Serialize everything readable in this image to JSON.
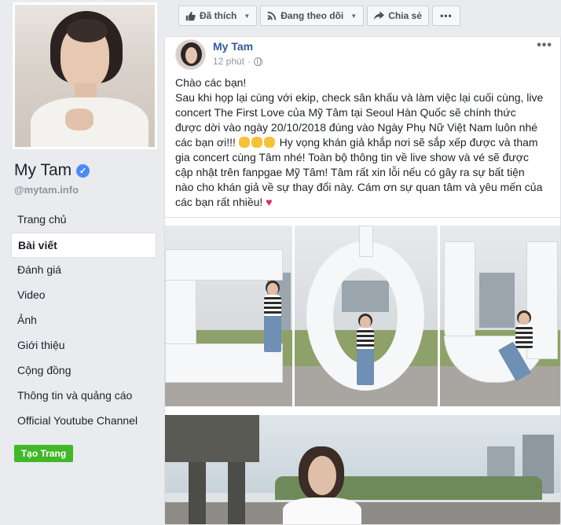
{
  "sidebar": {
    "page_name": "My Tam",
    "username": "@mytam.info",
    "nav": [
      {
        "label": "Trang chủ"
      },
      {
        "label": "Bài viết"
      },
      {
        "label": "Đánh giá"
      },
      {
        "label": "Video"
      },
      {
        "label": "Ảnh"
      },
      {
        "label": "Giới thiệu"
      },
      {
        "label": "Cộng đồng"
      },
      {
        "label": "Thông tin và quảng cáo"
      },
      {
        "label": "Official Youtube Channel"
      }
    ],
    "active_nav": "Bài viết",
    "create_page_label": "Tạo Trang"
  },
  "actionbar": {
    "liked_label": "Đã thích",
    "following_label": "Đang theo dõi",
    "share_label": "Chia sẻ",
    "more_label": "•••"
  },
  "post": {
    "author": "My Tam",
    "time": "12 phút",
    "privacy_icon": "globe-icon",
    "menu_label": "•••",
    "greeting": "Chào các bạn!",
    "body_part1": "Sau khi họp lại cùng với ekip, check sân khấu và làm việc lại cuối cùng, live concert The First Love của Mỹ Tâm tại Seoul Hàn Quốc sẽ chính thức được dời vào ngày 20/10/2018 đúng vào Ngày Phụ Nữ Việt Nam luôn nhé các bạn ơi!!!",
    "body_part2": "Hy vọng khán giả khắp nơi sẽ sắp xếp được và tham gia concert cùng Tâm nhé! Toàn bộ thông tin về live show và vé sẽ được cập nhật trên fanpgae Mỹ Tâm! Tâm rất xin lỗi nếu có gây ra sự bất tiện nào cho khán giả về sự thay đổi này. Cám ơn sự quan tâm và yêu mến của các bạn rất nhiều!",
    "heart": "♥"
  },
  "colors": {
    "background": "#e9ebee",
    "link": "#365899",
    "create_button": "#42b72a",
    "verified": "#4c8bf5"
  }
}
